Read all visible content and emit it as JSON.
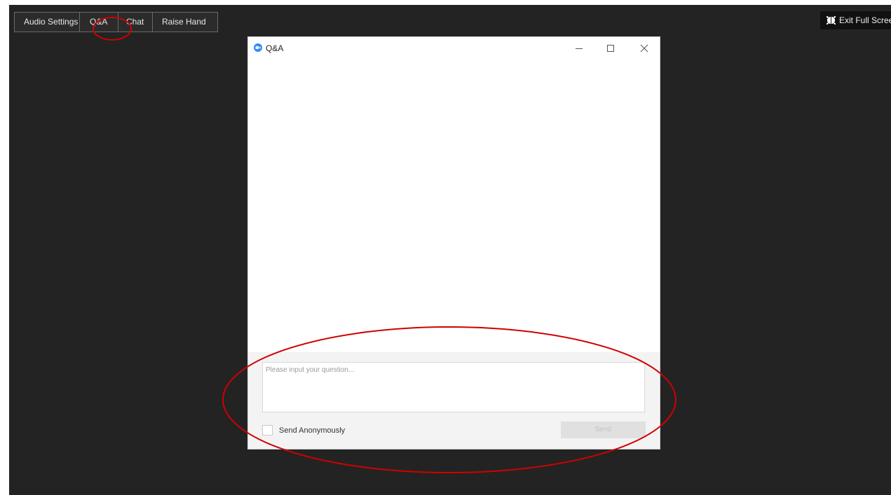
{
  "toolbar": {
    "buttons": [
      {
        "label": "Audio Settings"
      },
      {
        "label": "Q&A"
      },
      {
        "label": "Chat"
      },
      {
        "label": "Raise Hand"
      }
    ]
  },
  "exit_fullscreen": {
    "label": "Exit Full Screen",
    "icon": "exit-fullscreen-icon"
  },
  "qa_window": {
    "title": "Q&A",
    "logo_icon": "zoom-logo-icon",
    "controls": [
      "minimize-icon",
      "maximize-icon",
      "close-icon"
    ],
    "input": {
      "placeholder": "Please input your question...",
      "value": ""
    },
    "anonymous_label": "Send Anonymously",
    "anonymous_checked": false,
    "send_label": "Send"
  },
  "colors": {
    "background": "#232323",
    "annotation": "#d10000",
    "zoom_blue": "#2d8cff"
  }
}
